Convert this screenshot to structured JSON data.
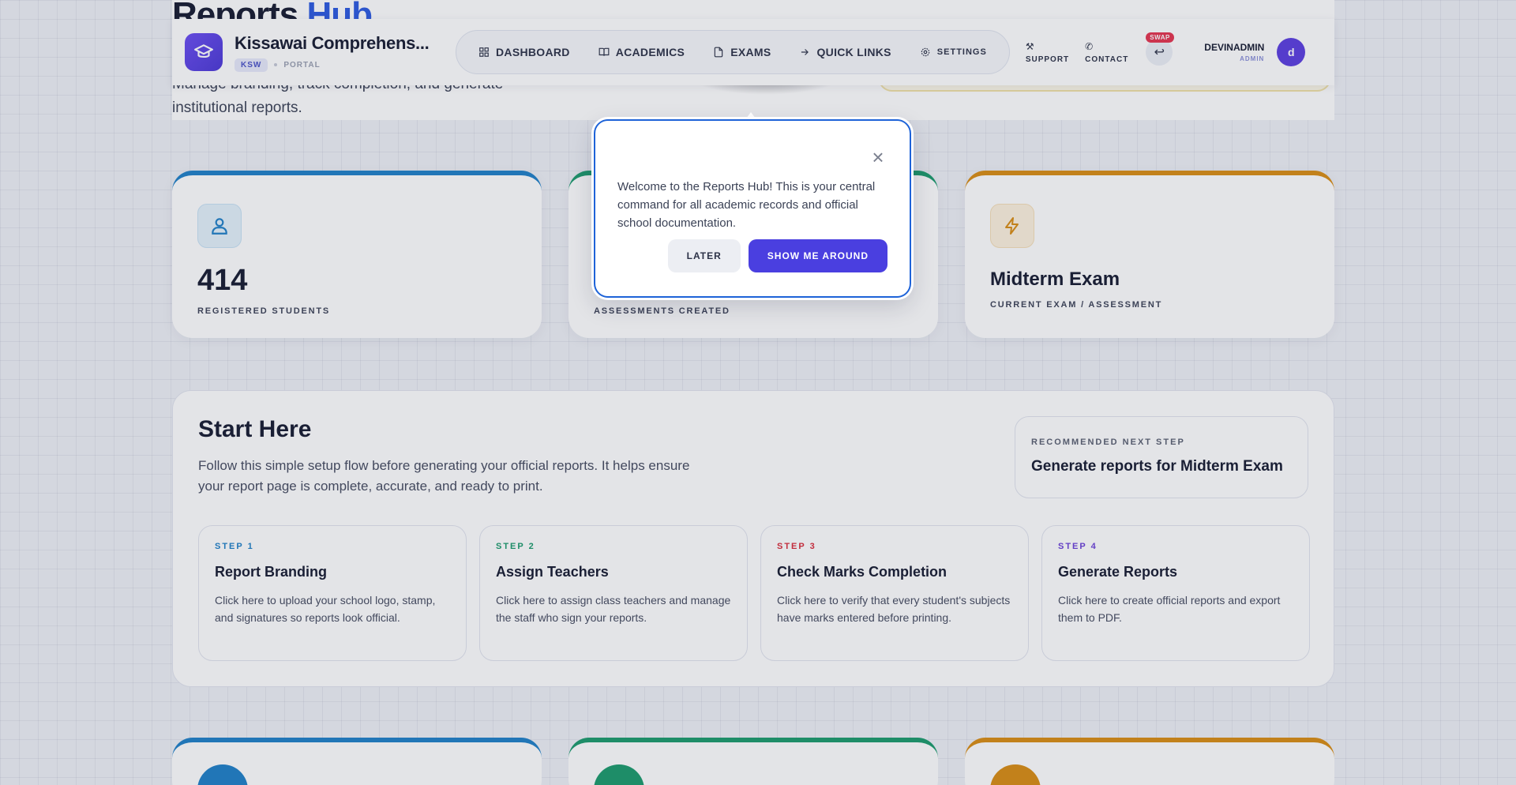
{
  "hero": {
    "title_part1": "Reports",
    "title_part2": "Hub",
    "subtitle": "Manage branding, track completion, and generate institutional reports."
  },
  "header": {
    "school_name": "Kissawai Comprehens...",
    "school_code": "KSW",
    "portal_label": "PORTAL",
    "nav": [
      {
        "label": "DASHBOARD",
        "icon": "grid-icon"
      },
      {
        "label": "ACADEMICS",
        "icon": "book-icon"
      },
      {
        "label": "EXAMS",
        "icon": "file-icon"
      },
      {
        "label": "QUICK LINKS",
        "icon": "arrow-right-icon"
      },
      {
        "label": "SETTINGS",
        "icon": "gear-icon"
      }
    ],
    "support_label": "SUPPORT",
    "contact_label": "CONTACT",
    "swap_badge": "SWAP",
    "user_name": "DEVINADMIN",
    "user_role": "ADMIN",
    "avatar_initial": "d"
  },
  "stats": [
    {
      "value": "414",
      "label": "REGISTERED STUDENTS",
      "color": "#1e7fc7"
    },
    {
      "value": "",
      "label": "ASSESSMENTS CREATED",
      "color": "#1a9a6c"
    },
    {
      "value": "Midterm Exam",
      "label": "CURRENT EXAM / ASSESSMENT",
      "color": "#d98c12"
    }
  ],
  "start_here": {
    "title": "Start Here",
    "description": "Follow this simple setup flow before generating your official reports. It helps ensure your report page is complete, accurate, and ready to print.",
    "recommended_label": "RECOMMENDED NEXT STEP",
    "recommended_value": "Generate reports for Midterm Exam",
    "steps": [
      {
        "num": "STEP 1",
        "title": "Report Branding",
        "desc": "Click here to upload your school logo, stamp, and signatures so reports look official.",
        "color": "#1e7fc7"
      },
      {
        "num": "STEP 2",
        "title": "Assign Teachers",
        "desc": "Click here to assign class teachers and manage the staff who sign your reports.",
        "color": "#1a9a6c"
      },
      {
        "num": "STEP 3",
        "title": "Check Marks Completion",
        "desc": "Click here to verify that every student's subjects have marks entered before printing.",
        "color": "#d92b3a"
      },
      {
        "num": "STEP 4",
        "title": "Generate Reports",
        "desc": "Click here to create official reports and export them to PDF.",
        "color": "#6b3fd8"
      }
    ]
  },
  "popup": {
    "message": "Welcome to the Reports Hub! This is your central command for all academic records and official school documentation.",
    "later_label": "LATER",
    "show_label": "SHOW ME AROUND",
    "close_glyph": "×"
  },
  "colors": {
    "accent": "#4a3fe0",
    "blue": "#1e7fc7",
    "green": "#1a9a6c",
    "amber": "#d98c12"
  }
}
